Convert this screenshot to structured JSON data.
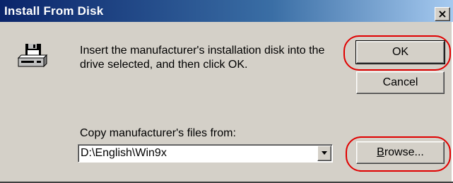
{
  "window": {
    "title": "Install From Disk",
    "close_glyph": "×"
  },
  "message": "Insert the manufacturer's installation disk into the drive selected, and then click OK.",
  "buttons": {
    "ok_label": "OK",
    "cancel_label": "Cancel",
    "browse_prefix": "",
    "browse_accel": "B",
    "browse_rest": "rowse..."
  },
  "copy_from": {
    "label": "Copy manufacturer's files from:",
    "value": "D:\\English\\Win9x"
  },
  "icons": {
    "disk": "floppy-disk-drive-icon",
    "dropdown": "chevron-down-icon",
    "close": "close-icon"
  },
  "colors": {
    "titlebar_start": "#0a246a",
    "titlebar_end": "#a6caf0",
    "dialog_face": "#d4d0c8",
    "highlight": "#e00000"
  }
}
